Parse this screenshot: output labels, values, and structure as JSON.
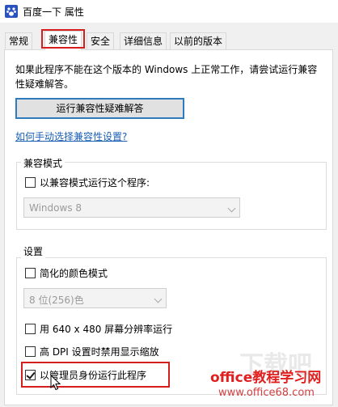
{
  "window": {
    "title": "百度一下 属性",
    "icon": "paw-icon"
  },
  "tabs": [
    {
      "label": "常规"
    },
    {
      "label": "兼容性"
    },
    {
      "label": "安全"
    },
    {
      "label": "详细信息"
    },
    {
      "label": "以前的版本"
    }
  ],
  "content": {
    "intro": "如果此程序不能在这个版本的 Windows 上正常工作，请尝试运行兼容性疑难解答。",
    "troubleshoot_button": "运行兼容性疑难解答",
    "manual_link": "如何手动选择兼容性设置?"
  },
  "compat_mode": {
    "group_label": "兼容模式",
    "checkbox_label": "以兼容模式运行这个程序:",
    "checked": false,
    "select_value": "Windows 8"
  },
  "settings": {
    "group_label": "设置",
    "reduced_color": {
      "label": "简化的颜色模式",
      "checked": false
    },
    "color_select": "8 位(256)色",
    "low_res": {
      "label": "用 640 x 480 屏幕分辨率运行",
      "checked": false
    },
    "high_dpi": {
      "label": "高 DPI 设置时禁用显示缩放",
      "checked": false
    },
    "run_as_admin": {
      "label": "以管理员身份运行此程序",
      "checked": true
    }
  },
  "watermark": {
    "brand": "office教程学习网",
    "url": "www.office68.com",
    "ghost": "下载吧"
  },
  "colors": {
    "highlight": "#d61e1e",
    "link": "#1a5fb4",
    "button_border": "#2e7bbf"
  }
}
